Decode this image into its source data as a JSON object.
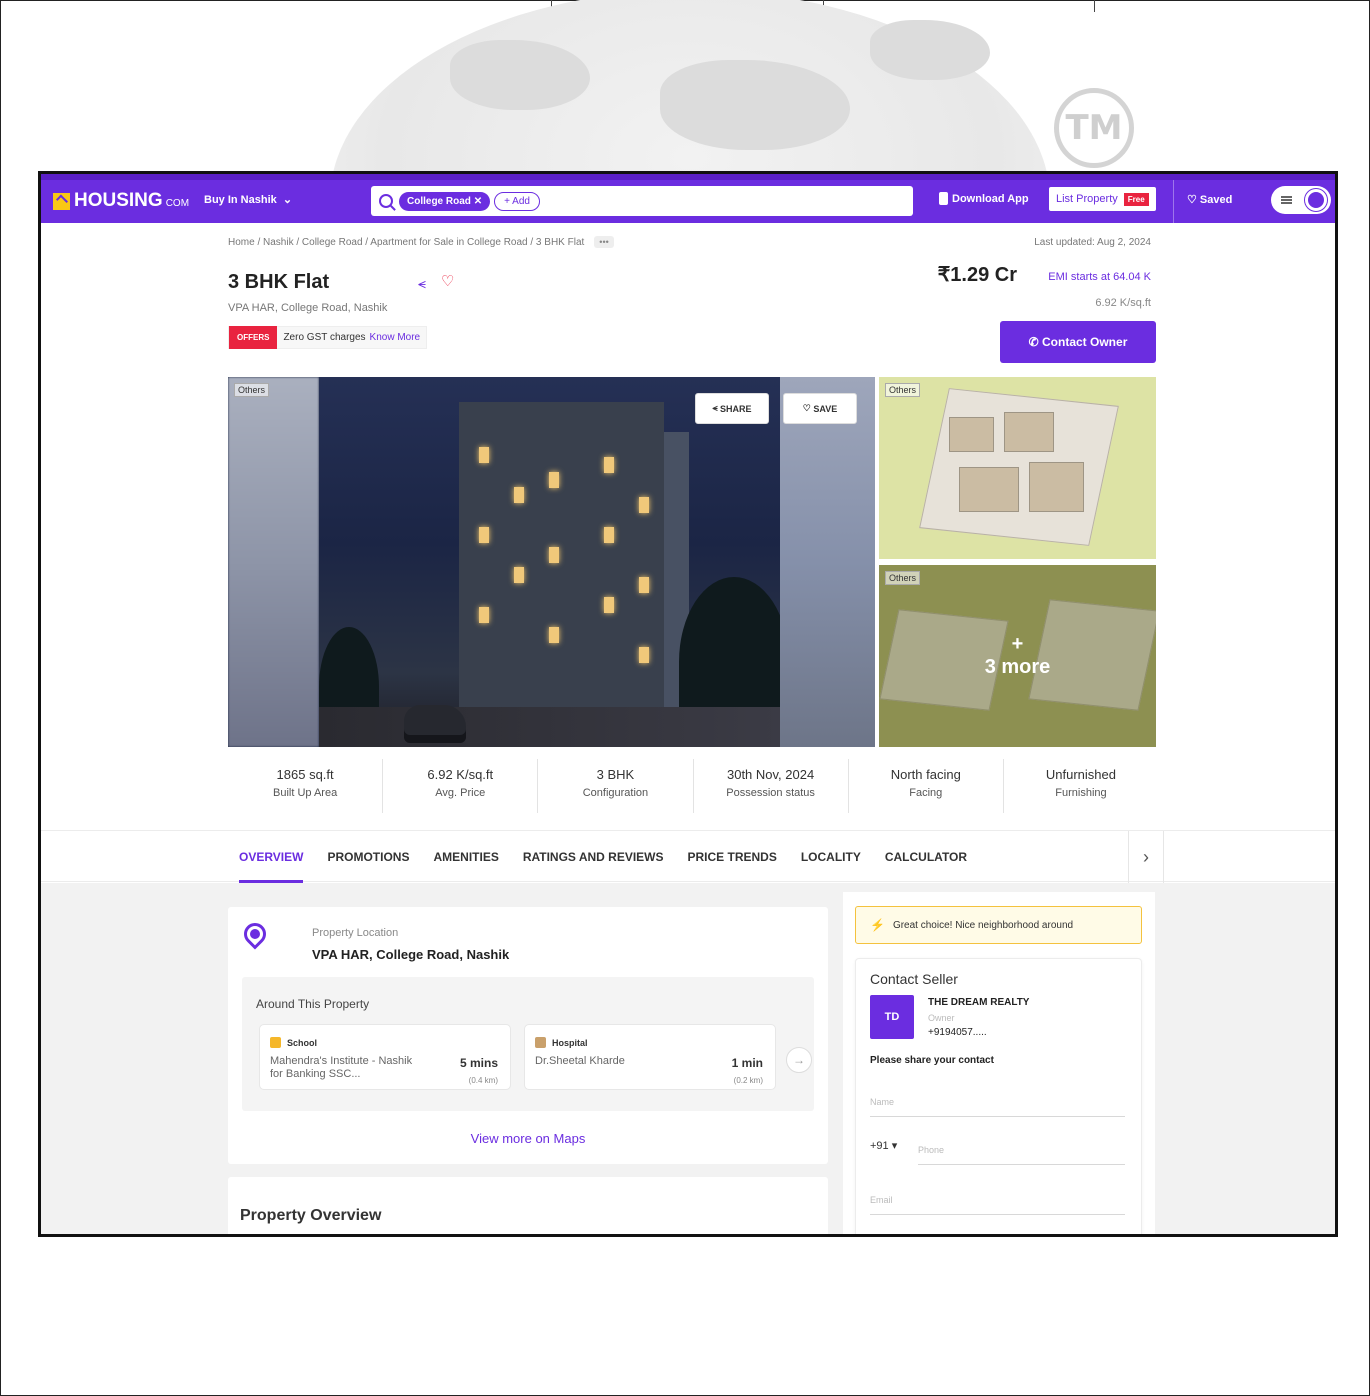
{
  "watermark": {
    "tm": "TM"
  },
  "nav": {
    "logo_main": "HOUSING",
    "logo_suffix": "COM",
    "city_selector": "Buy In Nashik",
    "search_chip": "College Road",
    "add_chip": "+ Add",
    "download_app": "Download App",
    "list_property": "List Property",
    "free_badge": "Free",
    "saved": "Saved"
  },
  "listing": {
    "breadcrumb": "Home / Nashik / College Road / Apartment for Sale in College Road / 3 BHK Flat",
    "breadcrumb_more": "•••",
    "last_updated": "Last updated: Aug 2, 2024",
    "title": "3 BHK Flat",
    "address": "VPA HAR, College Road, Nashik",
    "offer_tag": "OFFERS",
    "offer_text": "Zero GST charges",
    "offer_link": "Know More",
    "price": "₹1.29 Cr",
    "emi": "EMI starts at  64.04 K",
    "price_per_sqft": "6.92 K/sq.ft",
    "contact_button": "Contact Owner"
  },
  "gallery": {
    "main_tag": "Others",
    "share_label": "SHARE",
    "save_label": "SAVE",
    "side_top_tag": "Others",
    "side_bottom_tag": "Others",
    "more_plus": "+",
    "more_label": "3 more"
  },
  "stats": [
    {
      "value": "1865 sq.ft",
      "label": "Built Up Area"
    },
    {
      "value": "6.92 K/sq.ft",
      "label": "Avg. Price"
    },
    {
      "value": "3 BHK",
      "label": "Configuration"
    },
    {
      "value": "30th Nov, 2024",
      "label": "Possession status"
    },
    {
      "value": "North facing",
      "label": "Facing"
    },
    {
      "value": "Unfurnished",
      "label": "Furnishing"
    }
  ],
  "tabs": [
    "OVERVIEW",
    "PROMOTIONS",
    "AMENITIES",
    "RATINGS AND REVIEWS",
    "PRICE TRENDS",
    "LOCALITY",
    "CALCULATOR"
  ],
  "location": {
    "label": "Property Location",
    "value": "VPA HAR, College Road, Nashik",
    "around_title": "Around This Property",
    "pois": [
      {
        "type": "School",
        "name": "Mahendra's Institute - Nashik for Banking SSC...",
        "time": "5 mins",
        "distance": "(0.4 km)"
      },
      {
        "type": "Hospital",
        "name": "Dr.Sheetal Kharde",
        "time": "1 min",
        "distance": "(0.2 km)"
      }
    ],
    "view_more": "View more on Maps"
  },
  "overview": {
    "title": "Property Overview"
  },
  "sidebar": {
    "tip": "Great choice! Nice neighborhood around",
    "contact_heading": "Contact Seller",
    "initials": "TD",
    "seller_name": "THE DREAM REALTY",
    "seller_role": "Owner",
    "seller_phone": "+9194057.....",
    "share_contact": "Please share your contact",
    "name_placeholder": "Name",
    "country_code": "+91",
    "phone_placeholder": "Phone",
    "email_placeholder": "Email"
  },
  "colors": {
    "brand": "#6b2de0",
    "offer": "#e9233f",
    "logo_yellow": "#f9c814"
  }
}
